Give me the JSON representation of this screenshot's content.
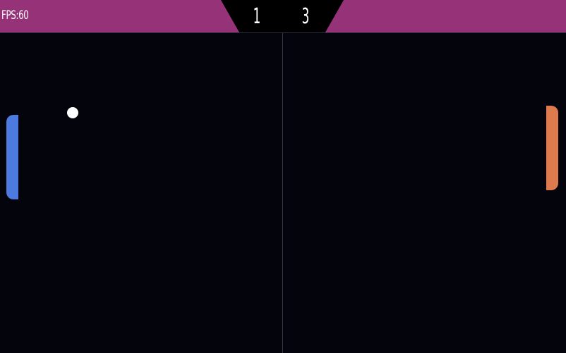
{
  "hud": {
    "fps_text": "FPS:60",
    "bar_color": "#963378"
  },
  "score": {
    "left": "1",
    "right": "3"
  },
  "paddles": {
    "left_color": "#4d7adf",
    "right_color": "#df7a4e"
  },
  "field": {
    "background": "#04040c"
  }
}
